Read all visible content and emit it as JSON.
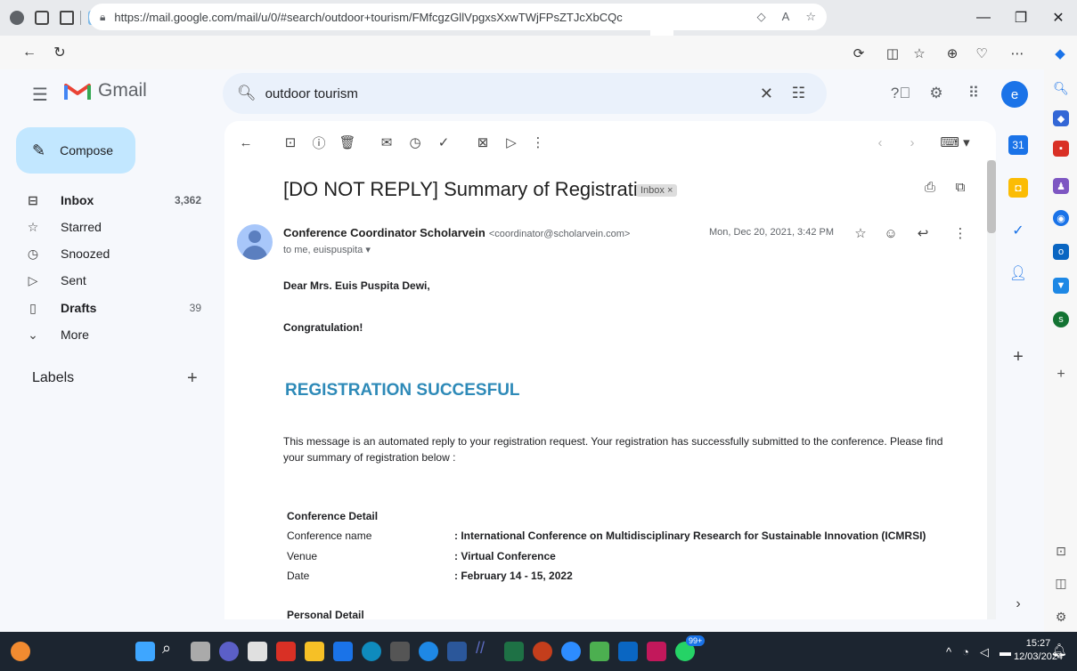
{
  "browser": {
    "url": "https://mail.google.com/mail/u/0/#search/outdoor+tourism/FMfcgzGllVpgxsXxwTWjFPsZTJcXbCQc",
    "active_tab_close": "×",
    "new_tab": "+"
  },
  "gmail": {
    "logo_text": "Gmail",
    "search_query": "outdoor tourism",
    "avatar_letter": "e"
  },
  "sidebar": {
    "compose_label": "Compose",
    "items": [
      {
        "label": "Inbox",
        "count": "3,362",
        "icon": "inbox-icon"
      },
      {
        "label": "Starred",
        "count": "",
        "icon": "star-icon"
      },
      {
        "label": "Snoozed",
        "count": "",
        "icon": "clock-icon"
      },
      {
        "label": "Sent",
        "count": "",
        "icon": "send-icon"
      },
      {
        "label": "Drafts",
        "count": "39",
        "icon": "draft-icon"
      },
      {
        "label": "More",
        "count": "",
        "icon": "chevron-down-icon"
      }
    ],
    "labels_heading": "Labels"
  },
  "email": {
    "subject": "[DO NOT REPLY] Summary of Registration",
    "label_chip": "Inbox ×",
    "sender_name": "Conference Coordinator Scholarvein",
    "sender_email": "<coordinator@scholarvein.com>",
    "to_line": "to me, euispuspita",
    "date": "Mon, Dec 20, 2021, 3:42 PM",
    "greeting": "Dear Mrs. Euis Puspita Dewi,",
    "congrats": "Congratulation!",
    "heading": "REGISTRATION SUCCESFUL",
    "paragraph_line1": "This message is an automated reply to your registration request. Your registration has successfully submitted to the conference. Please find",
    "paragraph_line2": "your summary of registration below :",
    "conference_detail_heading": "Conference Detail",
    "details": [
      {
        "key": "Conference name",
        "value": ": International Conference on Multidisciplinary Research for Sustainable Innovation (ICMRSI)"
      },
      {
        "key": "Venue",
        "value": ": Virtual Conference"
      },
      {
        "key": "Date",
        "value": ": February 14 - 15, 2022"
      }
    ],
    "personal_detail_heading": "Personal Detail"
  },
  "taskbar": {
    "time": "15:27",
    "date": "12/03/2024",
    "whatsapp_badge": "99+"
  }
}
